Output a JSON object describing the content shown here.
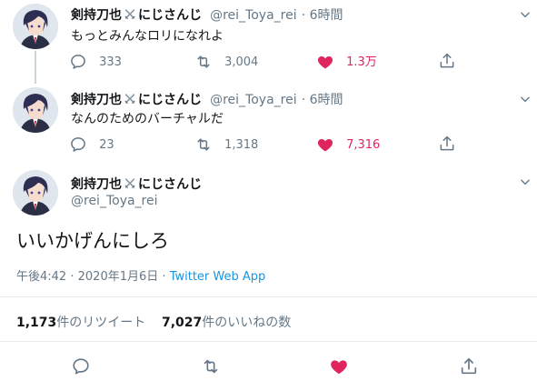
{
  "author": {
    "name_prefix": "剣持刀也",
    "name_suffix": "にじさんじ",
    "handle": "@rei_Toya_rei"
  },
  "tweets": [
    {
      "time": "6時間",
      "text": "もっとみんなロリになれよ",
      "replies": "",
      "reply_count": "333",
      "retweet_count": "3,004",
      "like_count": "1.3万"
    },
    {
      "time": "6時間",
      "text": "なんのためのバーチャルだ",
      "reply_count": "23",
      "retweet_count": "1,318",
      "like_count": "7,316"
    }
  ],
  "main_tweet": {
    "text": "いいかげんにしろ",
    "time": "午後4:42",
    "separator": "·",
    "date": "2020年1月6日",
    "source": "Twitter Web App"
  },
  "stats": {
    "retweets_number": "1,173",
    "retweets_label": "件のリツイート",
    "likes_number": "7,027",
    "likes_label": "件のいいねの数"
  },
  "icons": [
    "reply-icon",
    "retweet-icon",
    "like-icon",
    "share-icon",
    "chevron-down-icon",
    "crossed-swords-icon"
  ],
  "colors": {
    "like": "#e0245e",
    "link": "#1b95e0",
    "secondary": "#657786",
    "divider": "#e6ecf0"
  }
}
